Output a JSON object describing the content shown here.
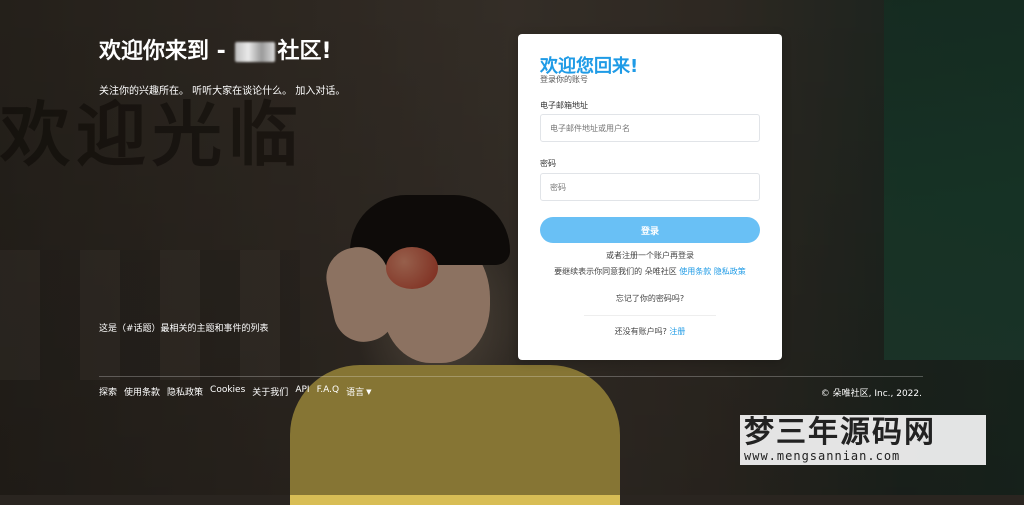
{
  "hero": {
    "title_prefix": "欢迎你来到 -",
    "title_suffix": "社区!",
    "subtitle": "关注你的兴趣所在。 听听大家在谈论什么。 加入对话。",
    "topics_text": "这是（#话题）最相关的主题和事件的列表"
  },
  "background": {
    "sign_text": "欢迎光临"
  },
  "card": {
    "title": "欢迎您回来!",
    "subtitle": "登录你的账号",
    "email_label": "电子邮箱地址",
    "email_placeholder": "电子邮件地址或用户名",
    "password_label": "密码",
    "password_placeholder": "密码",
    "login_button": "登录",
    "or_register_text": "或者注册一个账户再登录",
    "terms_prefix": "要继续表示你同意我们的 朵唯社区",
    "terms_link": "使用条款",
    "privacy_link": "隐私政策",
    "forgot_password": "忘记了你的密码吗?",
    "no_account_text": "还没有账户吗?",
    "register_link": "注册"
  },
  "footer": {
    "links": [
      "探索",
      "使用条款",
      "隐私政策",
      "Cookies",
      "关于我们",
      "API",
      "F.A.Q"
    ],
    "language_label": "语言",
    "copyright": "© 朵唯社区, Inc., 2022."
  },
  "watermark": {
    "chinese": "梦三年源码网",
    "url": "www.mengsannian.com"
  },
  "colors": {
    "accent": "#1f9be6",
    "button": "#69c0f5"
  }
}
